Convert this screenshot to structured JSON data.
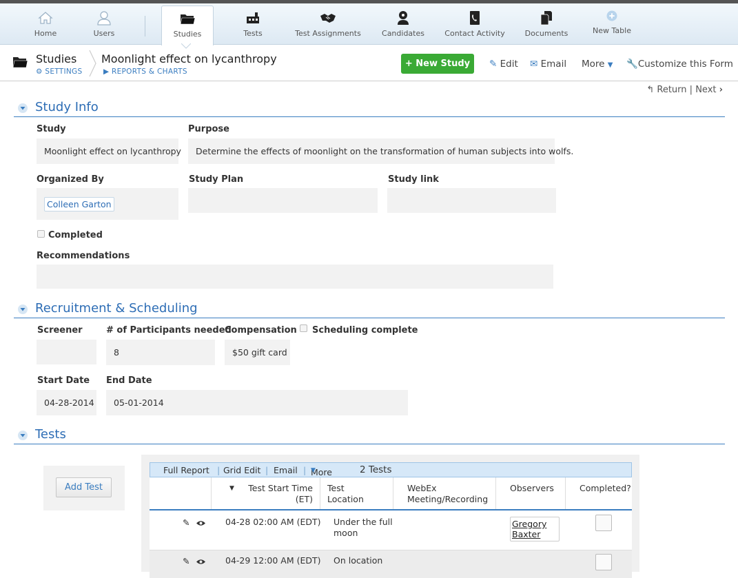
{
  "nav": {
    "items": [
      {
        "label": "Home",
        "icon": "home-icon"
      },
      {
        "label": "Users",
        "icon": "user-icon"
      },
      {
        "label": "Studies",
        "icon": "folder-icon"
      },
      {
        "label": "Tests",
        "icon": "tests-icon"
      },
      {
        "label": "Test Assignments",
        "icon": "handshake-icon"
      },
      {
        "label": "Candidates",
        "icon": "candidate-icon"
      },
      {
        "label": "Contact Activity",
        "icon": "phone-book-icon"
      },
      {
        "label": "Documents",
        "icon": "documents-icon"
      },
      {
        "label": "New Table",
        "icon": "plus-circle-icon"
      }
    ]
  },
  "header": {
    "section": "Studies",
    "settings": "SETTINGS",
    "record_title": "Moonlight effect on lycanthropy",
    "reports": "REPORTS & CHARTS",
    "new_button": "+ New Study",
    "edit": "Edit",
    "email": "Email",
    "more": "More",
    "customize": "Customize this Form",
    "return": "Return",
    "sep": "|",
    "next": "Next"
  },
  "study_info": {
    "title": "Study Info",
    "study_label": "Study",
    "study_value": "Moonlight effect on lycanthropy",
    "purpose_label": "Purpose",
    "purpose_value": "Determine the effects of moonlight on the transformation of human subjects into wolfs.",
    "organized_by_label": "Organized By",
    "organized_by_value": "Colleen Garton",
    "study_plan_label": "Study Plan",
    "study_link_label": "Study link",
    "completed_label": "Completed",
    "recommendations_label": "Recommendations"
  },
  "recruitment": {
    "title": "Recruitment & Scheduling",
    "screener_label": "Screener",
    "participants_label": "# of Participants needed",
    "participants_value": "8",
    "compensation_label": "Compensation",
    "compensation_value": "$50 gift card",
    "scheduling_label": "Scheduling complete",
    "start_label": "Start Date",
    "start_value": "04-28-2014",
    "end_label": "End Date",
    "end_value": "05-01-2014"
  },
  "tests": {
    "title": "Tests",
    "add_button": "Add Test",
    "toolbar": {
      "full_report": "Full Report",
      "grid_edit": "Grid Edit",
      "email": "Email",
      "more": "More",
      "sep": "|",
      "count": "2 Tests"
    },
    "columns": {
      "start_time_1": "Test Start Time",
      "start_time_2": "(ET)",
      "location_1": "Test",
      "location_2": "Location",
      "webex_1": "WebEx",
      "webex_2": "Meeting/Recording",
      "observers": "Observers",
      "completed": "Completed?"
    },
    "rows": [
      {
        "start": "04-28 02:00 AM (EDT)",
        "location_1": "Under the full",
        "location_2": "moon",
        "observer_1": "Gregory",
        "observer_2": "Baxter"
      },
      {
        "start": "04-29 12:00 AM (EDT)",
        "location_1": "On location"
      }
    ]
  }
}
